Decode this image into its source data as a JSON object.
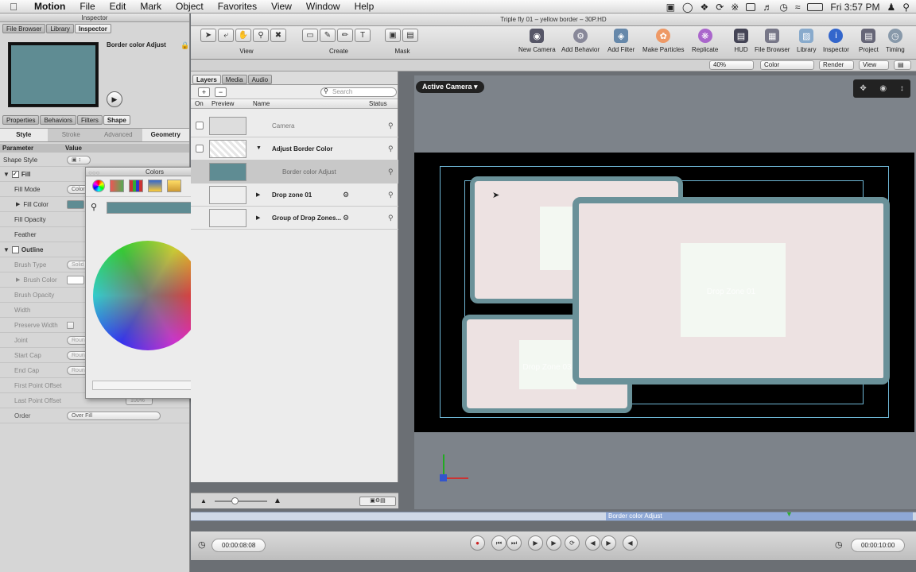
{
  "menubar": {
    "app": "Motion",
    "items": [
      "File",
      "Edit",
      "Mark",
      "Object",
      "Favorites",
      "View",
      "Window",
      "Help"
    ],
    "clock": "Fri 3:57 PM"
  },
  "document_title": "Triple fly 01 – yellow border – 30P.HD",
  "inspector": {
    "title": "Inspector",
    "top_tabs": [
      "File Browser",
      "Library",
      "Inspector"
    ],
    "preview_name": "Border color Adjust",
    "sub_tabs": [
      "Properties",
      "Behaviors",
      "Filters",
      "Shape"
    ],
    "shape_tabs": [
      "Style",
      "Stroke",
      "Advanced",
      "Geometry"
    ],
    "col_param": "Parameter",
    "col_value": "Value",
    "rows": [
      {
        "label": "Shape Style",
        "value": ""
      },
      {
        "label": "Fill",
        "value": ""
      },
      {
        "label": "Fill Mode",
        "value": "Color"
      },
      {
        "label": "Fill Color",
        "value": ""
      },
      {
        "label": "Fill Opacity",
        "value": ""
      },
      {
        "label": "Feather",
        "value": ""
      },
      {
        "label": "Outline",
        "value": ""
      },
      {
        "label": "Brush Type",
        "value": "Solid"
      },
      {
        "label": "Brush Color",
        "value": ""
      },
      {
        "label": "Brush Opacity",
        "value": ""
      },
      {
        "label": "Width",
        "value": ""
      },
      {
        "label": "Preserve Width",
        "value": ""
      },
      {
        "label": "Joint",
        "value": "Round"
      },
      {
        "label": "Start Cap",
        "value": "Round"
      },
      {
        "label": "End Cap",
        "value": "Round"
      },
      {
        "label": "First Point Offset",
        "value": ""
      },
      {
        "label": "Last Point Offset",
        "value": "100%"
      },
      {
        "label": "Order",
        "value": "Over Fill"
      }
    ]
  },
  "colors_panel": {
    "title": "Colors",
    "swatch_color": "#5f8c93"
  },
  "toolbar": {
    "groups": [
      "View",
      "Create",
      "Mask"
    ],
    "right_items": [
      "New Camera",
      "Add Behavior",
      "Add Filter",
      "Make Particles",
      "Replicate",
      "HUD",
      "File Browser",
      "Library",
      "Inspector",
      "Project",
      "Timing"
    ],
    "zoom": "40%",
    "channels": "Color",
    "render": "Render",
    "view": "View"
  },
  "layers": {
    "tabs": [
      "Layers",
      "Media",
      "Audio"
    ],
    "search_placeholder": "Search",
    "columns": [
      "On",
      "Preview",
      "Name",
      "Status"
    ],
    "rows": [
      {
        "name": "Camera"
      },
      {
        "name": "Adjust Border Color"
      },
      {
        "name": "Border color Adjust"
      },
      {
        "name": "Drop zone 01"
      },
      {
        "name": "Group of Drop Zones..."
      }
    ]
  },
  "canvas": {
    "camera_button": "Active Camera ▾",
    "zones": [
      "Drop Zone 02",
      "Drop Zone 01",
      "Drop Zone 03"
    ]
  },
  "timeline": {
    "clip_label": "Border color Adjust",
    "current_time": "00:00:08:08",
    "duration": "00:00:10:00"
  }
}
